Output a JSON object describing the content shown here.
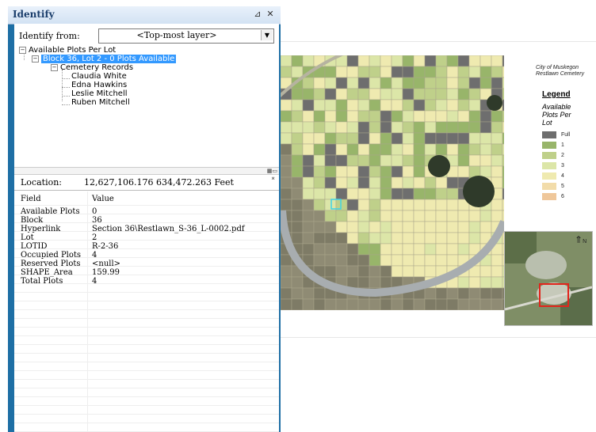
{
  "identify": {
    "title": "Identify",
    "pin_icon": "pin-icon",
    "close_icon": "close-icon",
    "identify_from_label": "Identify from:",
    "identify_from_value": "<Top-most layer>",
    "tree": {
      "root": "Available Plots Per Lot",
      "selected": "Block 36, Lot 2 - 0 Plots Available",
      "group": "Cemetery Records",
      "names": [
        "Claudia White",
        "Edna Hawkins",
        "Leslie Mitchell",
        "Ruben Mitchell"
      ]
    },
    "location_label": "Location:",
    "location_value": "12,627,106.176  634,472.263 Feet",
    "grid": {
      "headers": [
        "Field",
        "Value"
      ],
      "rows": [
        [
          "Available Plots",
          "0"
        ],
        [
          "Block",
          "36"
        ],
        [
          "Hyperlink",
          "Section 36\\Restlawn_S-36_L-0002.pdf"
        ],
        [
          "Lot",
          "2"
        ],
        [
          "LOTID",
          "R-2-36"
        ],
        [
          "Occupied Plots",
          "4"
        ],
        [
          "Reserved Plots",
          "<null>"
        ],
        [
          "SHAPE_Area",
          "159.99"
        ],
        [
          "Total Plots",
          "4"
        ]
      ]
    }
  },
  "map": {
    "title_line1": "City of Muskegon",
    "title_line2": "Restlawn Cemetery",
    "legend_heading": "Legend",
    "legend_sub": [
      "Available",
      "Plots Per",
      "Lot"
    ],
    "legend": [
      {
        "label": "Full",
        "color": "#6e6e6e"
      },
      {
        "label": "1",
        "color": "#98b56a"
      },
      {
        "label": "2",
        "color": "#bfd08a"
      },
      {
        "label": "3",
        "color": "#dce6a8"
      },
      {
        "label": "4",
        "color": "#efeab0"
      },
      {
        "label": "5",
        "color": "#f2dcaa"
      },
      {
        "label": "6",
        "color": "#efc79a"
      }
    ],
    "north_symbol": "N"
  }
}
